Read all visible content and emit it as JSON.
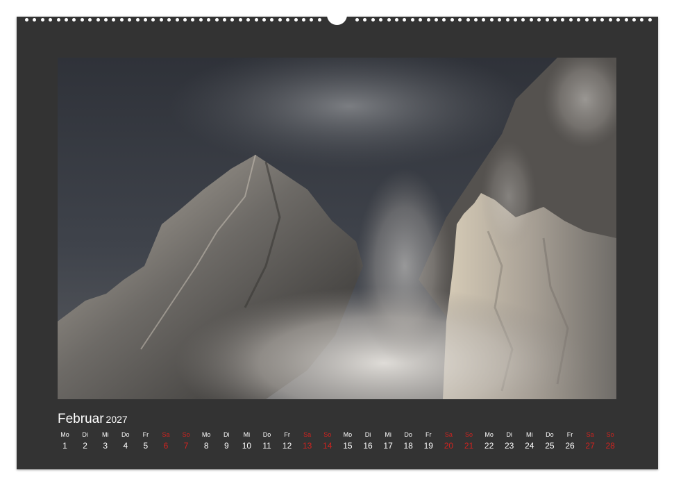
{
  "calendar": {
    "month": "Februar",
    "year": "2027",
    "weekend_color": "#d2231f",
    "text_color": "#ffffff",
    "background_color": "#333333",
    "days": [
      {
        "weekday": "Mo",
        "day": "1",
        "weekend": false
      },
      {
        "weekday": "Di",
        "day": "2",
        "weekend": false
      },
      {
        "weekday": "Mi",
        "day": "3",
        "weekend": false
      },
      {
        "weekday": "Do",
        "day": "4",
        "weekend": false
      },
      {
        "weekday": "Fr",
        "day": "5",
        "weekend": false
      },
      {
        "weekday": "Sa",
        "day": "6",
        "weekend": true
      },
      {
        "weekday": "So",
        "day": "7",
        "weekend": true
      },
      {
        "weekday": "Mo",
        "day": "8",
        "weekend": false
      },
      {
        "weekday": "Di",
        "day": "9",
        "weekend": false
      },
      {
        "weekday": "Mi",
        "day": "10",
        "weekend": false
      },
      {
        "weekday": "Do",
        "day": "11",
        "weekend": false
      },
      {
        "weekday": "Fr",
        "day": "12",
        "weekend": false
      },
      {
        "weekday": "Sa",
        "day": "13",
        "weekend": true
      },
      {
        "weekday": "So",
        "day": "14",
        "weekend": true
      },
      {
        "weekday": "Mo",
        "day": "15",
        "weekend": false
      },
      {
        "weekday": "Di",
        "day": "16",
        "weekend": false
      },
      {
        "weekday": "Mi",
        "day": "17",
        "weekend": false
      },
      {
        "weekday": "Do",
        "day": "18",
        "weekend": false
      },
      {
        "weekday": "Fr",
        "day": "19",
        "weekend": false
      },
      {
        "weekday": "Sa",
        "day": "20",
        "weekend": true
      },
      {
        "weekday": "So",
        "day": "21",
        "weekend": true
      },
      {
        "weekday": "Mo",
        "day": "22",
        "weekend": false
      },
      {
        "weekday": "Di",
        "day": "23",
        "weekend": false
      },
      {
        "weekday": "Mi",
        "day": "24",
        "weekend": false
      },
      {
        "weekday": "Do",
        "day": "25",
        "weekend": false
      },
      {
        "weekday": "Fr",
        "day": "26",
        "weekend": false
      },
      {
        "weekday": "Sa",
        "day": "27",
        "weekend": true
      },
      {
        "weekday": "So",
        "day": "28",
        "weekend": true
      }
    ]
  }
}
